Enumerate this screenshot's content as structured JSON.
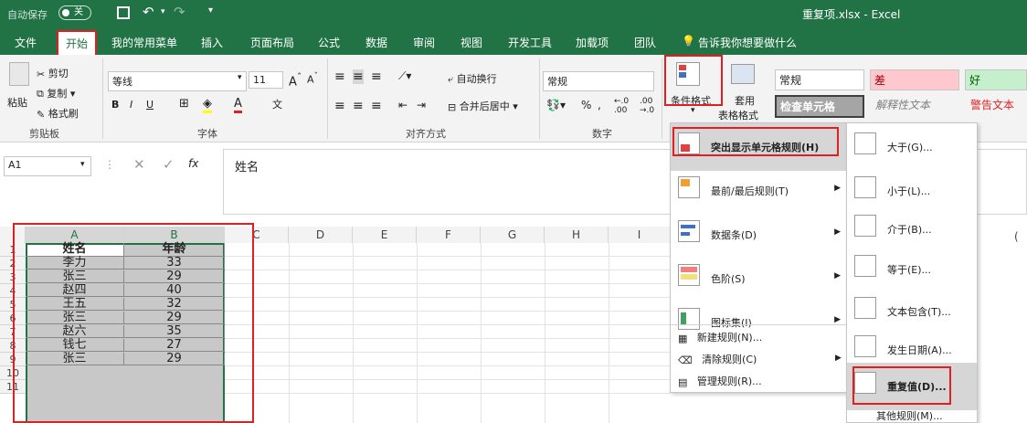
{
  "titlebar": {
    "autosave": "自动保存",
    "autosave_state": "关",
    "file_name": "重复项.xlsx - Excel"
  },
  "menubar": {
    "tabs": [
      "文件",
      "开始",
      "我的常用菜单",
      "插入",
      "页面布局",
      "公式",
      "数据",
      "审阅",
      "视图",
      "开发工具",
      "加载项",
      "团队"
    ],
    "tell_me": "告诉我你想要做什么"
  },
  "ribbon": {
    "clipboard": {
      "paste": "粘贴",
      "cut": "剪切",
      "copy": "复制",
      "format_painter": "格式刷",
      "group": "剪贴板"
    },
    "font": {
      "name": "等线",
      "size": "11",
      "bold": "B",
      "italic": "I",
      "underline": "U",
      "group": "字体"
    },
    "alignment": {
      "wrap": "自动换行",
      "merge": "合并后居中",
      "group": "对齐方式"
    },
    "number": {
      "format": "常规",
      "percent": "%",
      "group": "数字"
    },
    "styles": {
      "conditional": "条件格式",
      "table_format_1": "套用",
      "table_format_2": "表格格式",
      "normal": "常规",
      "bad": "差",
      "good": "好",
      "check_cell": "检查单元格",
      "explanatory": "解释性文本",
      "warning": "警告文本"
    }
  },
  "formula": {
    "name_box": "A1",
    "fx": "fx",
    "content": "姓名"
  },
  "grid": {
    "columns": [
      "A",
      "B",
      "C",
      "D",
      "E",
      "F",
      "G",
      "H",
      "I"
    ],
    "rows": [
      "1",
      "2",
      "3",
      "4",
      "5",
      "6",
      "7",
      "8",
      "9",
      "10",
      "11"
    ],
    "header": [
      "姓名",
      "年龄"
    ],
    "data": [
      [
        "李力",
        "33"
      ],
      [
        "张三",
        "29"
      ],
      [
        "赵四",
        "40"
      ],
      [
        "王五",
        "32"
      ],
      [
        "张三",
        "29"
      ],
      [
        "赵六",
        "35"
      ],
      [
        "钱七",
        "27"
      ],
      [
        "张三",
        "29"
      ]
    ]
  },
  "cf_menu": {
    "items": [
      "突出显示单元格规则(H)",
      "最前/最后规则(T)",
      "数据条(D)",
      "色阶(S)",
      "图标集(I)"
    ],
    "small": [
      "新建规则(N)...",
      "清除规则(C)",
      "管理规则(R)..."
    ]
  },
  "sub_menu": {
    "items": [
      "大于(G)...",
      "小于(L)...",
      "介于(B)...",
      "等于(E)...",
      "文本包含(T)...",
      "发生日期(A)...",
      "重复值(D)..."
    ],
    "more": "其他规则(M)..."
  },
  "colors": {
    "excel_green": "#217346",
    "highlight_red": "#e02020"
  }
}
